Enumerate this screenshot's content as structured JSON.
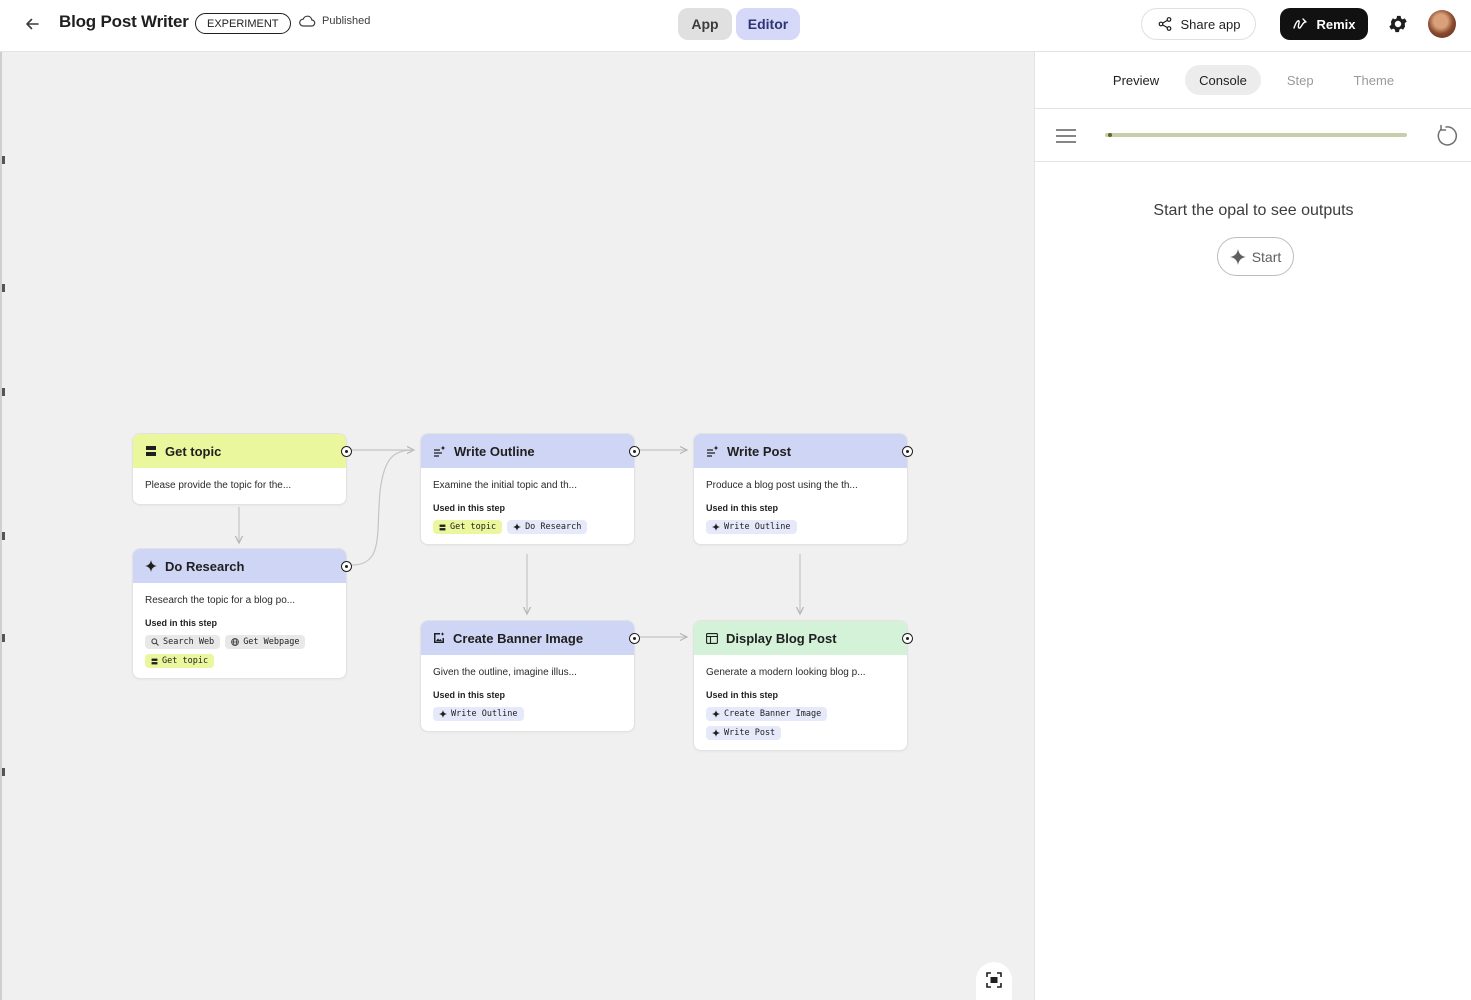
{
  "header": {
    "title": "Blog Post Writer",
    "badge": "EXPERIMENT",
    "status": "Published",
    "mode_app": "App",
    "mode_editor": "Editor",
    "share_label": "Share app",
    "remix_label": "Remix"
  },
  "colors": {
    "yellow_step": "#eaf79c",
    "blue_step": "#cfd5f5",
    "green_step": "#d4f2d7",
    "editor_active": "#d6d8f7"
  },
  "nodes": {
    "get_topic": {
      "title": "Get topic",
      "icon": "input-icon",
      "desc": "Please provide the topic for the...",
      "used": "",
      "chips": []
    },
    "do_research": {
      "title": "Do Research",
      "icon": "spark-icon",
      "desc": "Research the topic for a blog po...",
      "used": "Used in this step",
      "chips": [
        "Search Web",
        "Get Webpage",
        "Get topic"
      ]
    },
    "write_outline": {
      "title": "Write Outline",
      "icon": "text-generate-icon",
      "desc": "Examine the initial topic and th...",
      "used": "Used in this step",
      "chips": [
        "Get topic",
        "Do Research"
      ]
    },
    "write_post": {
      "title": "Write Post",
      "icon": "text-generate-icon",
      "desc": "Produce a blog post using the th...",
      "used": "Used in this step",
      "chips": [
        "Write Outline"
      ]
    },
    "create_banner": {
      "title": "Create Banner Image",
      "icon": "image-generate-icon",
      "desc": "Given the outline, imagine illus...",
      "used": "Used in this step",
      "chips": [
        "Write Outline"
      ]
    },
    "display_post": {
      "title": "Display Blog Post",
      "icon": "web-layout-icon",
      "desc": "Generate a modern looking blog p...",
      "used": "Used in this step",
      "chips": [
        "Create Banner Image",
        "Write Post"
      ]
    }
  },
  "panel": {
    "tabs": [
      "Preview",
      "Console",
      "Step",
      "Theme"
    ],
    "selected_tab": "Console",
    "progress": 0.01,
    "empty_message": "Start the opal to see outputs",
    "start_label": "Start"
  }
}
